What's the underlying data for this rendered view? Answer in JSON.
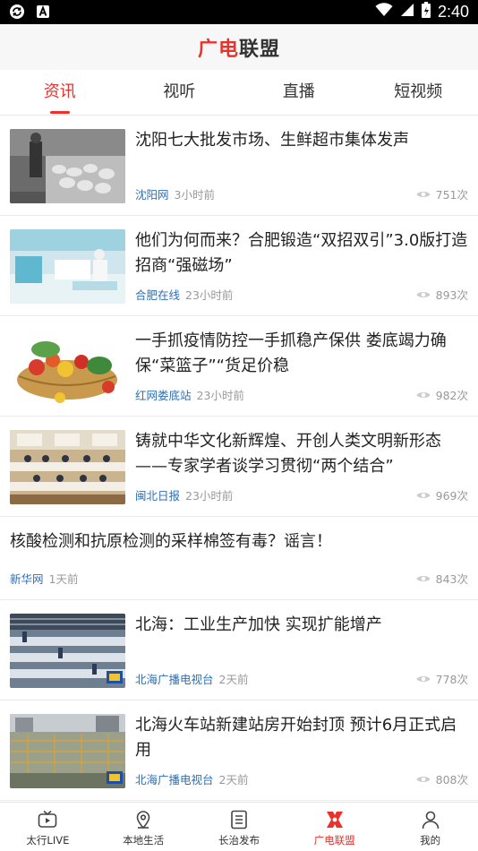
{
  "status_bar": {
    "time": "2:40",
    "icons": [
      "sync-icon",
      "a-icon",
      "wifi-icon",
      "signal-icon",
      "battery-icon"
    ]
  },
  "header": {
    "logo_part1": "广电",
    "logo_part2": "联盟"
  },
  "tabs": [
    {
      "label": "资讯",
      "active": true
    },
    {
      "label": "视听",
      "active": false
    },
    {
      "label": "直播",
      "active": false
    },
    {
      "label": "短视频",
      "active": false
    }
  ],
  "feed": [
    {
      "title": "沈阳七大批发市场、生鲜超市集体发声",
      "source": "沈阳网",
      "time": "3小时前",
      "views": "751次",
      "thumb": "market"
    },
    {
      "title": "他们为何而来？合肥锻造“双招双引”3.0版打造招商“强磁场”",
      "source": "合肥在线",
      "time": "23小时前",
      "views": "893次",
      "thumb": "lab"
    },
    {
      "title": "一手抓疫情防控一手抓稳产保供 娄底竭力确保“菜篮子”“货足价稳",
      "source": "红网娄底站",
      "time": "23小时前",
      "views": "982次",
      "thumb": "vegetables"
    },
    {
      "title": "铸就中华文化新辉煌、开创人类文明新形态——专家学者谈学习贯彻“两个结合”",
      "source": "闽北日报",
      "time": "23小时前",
      "views": "969次",
      "thumb": "meeting"
    },
    {
      "title": "核酸检测和抗原检测的采样棉签有毒？谣言！",
      "source": "新华网",
      "time": "1天前",
      "views": "843次",
      "thumb": null
    },
    {
      "title": "北海：工业生产加快 实现扩能增产",
      "source": "北海广播电视台",
      "time": "2天前",
      "views": "778次",
      "thumb": "factory"
    },
    {
      "title": "北海火车站新建站房开始封顶 预计6月正式启用",
      "source": "北海广播电视台",
      "time": "2天前",
      "views": "808次",
      "thumb": "construction"
    }
  ],
  "bottom_nav": [
    {
      "label": "太行LIVE",
      "icon": "tv-icon",
      "active": false
    },
    {
      "label": "本地生活",
      "icon": "location-icon",
      "active": false
    },
    {
      "label": "长治发布",
      "icon": "document-icon",
      "active": false
    },
    {
      "label": "广电联盟",
      "icon": "alliance-icon",
      "active": true
    },
    {
      "label": "我的",
      "icon": "profile-icon",
      "active": false
    }
  ],
  "colors": {
    "accent": "#e8322b",
    "source_blue": "#2f6fb4",
    "meta_gray": "#999999"
  }
}
